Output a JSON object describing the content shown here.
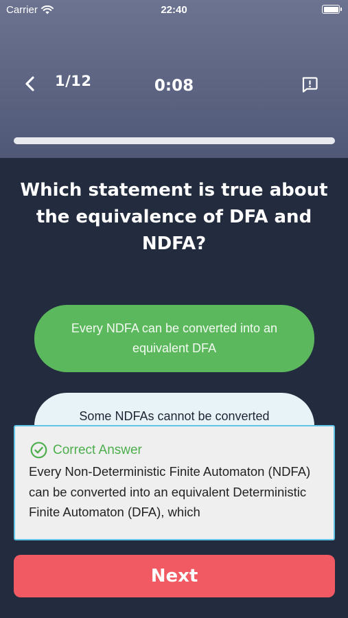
{
  "status_bar": {
    "carrier": "Carrier",
    "time": "22:40"
  },
  "header": {
    "progress": "1/12",
    "timer": "0:08",
    "progress_fraction": 1.0
  },
  "question": {
    "text": "Which statement is true about the equivalence of DFA and NDFA?"
  },
  "options": [
    {
      "label": "Every NDFA can be converted into an equivalent DFA",
      "state": "correct"
    },
    {
      "label": "Some NDFAs cannot be converted",
      "state": "unselected"
    }
  ],
  "answer_panel": {
    "title": "Correct Answer",
    "explanation": "Every Non-Deterministic Finite Automaton (NDFA) can be converted into an equivalent Deterministic Finite Automaton (DFA), which"
  },
  "next_button": {
    "label": "Next"
  },
  "colors": {
    "header_top": "#6c7391",
    "background": "#232c3e",
    "correct_green": "#5cb85c",
    "option_light": "#e8f3f8",
    "panel_border": "#5fc4e8",
    "next_red": "#f25a63"
  }
}
